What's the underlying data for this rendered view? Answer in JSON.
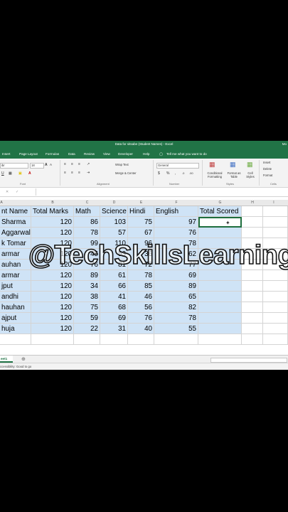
{
  "window": {
    "title": "Data for sitsabe (Student Names) - Excel",
    "user_label": "Mo"
  },
  "ribbon_tabs": [
    "Insert",
    "Page Layout",
    "Formulas",
    "Data",
    "Review",
    "View",
    "Developer",
    "Help"
  ],
  "tell_me": "Tell me what you want to do",
  "ribbon": {
    "font_name": "ibr",
    "font_size": "18",
    "wrap_text": "Wrap Text",
    "merge_center": "Merge & Center",
    "number_format": "General",
    "conditional_formatting": "Conditional Formatting",
    "format_as_table": "Format as Table",
    "cell_styles": "Cell Styles",
    "insert": "Insert",
    "delete": "Delete",
    "format": "Format",
    "groups": {
      "font": "Font",
      "alignment": "Alignment",
      "number": "Number",
      "styles": "Styles",
      "cells": "Cells"
    }
  },
  "columns": [
    "A",
    "B",
    "C",
    "D",
    "E",
    "F",
    "G",
    "H",
    "I"
  ],
  "table": {
    "headers": [
      "nt Name",
      "Total Marks",
      "Math",
      "Science",
      "Hindi",
      "English",
      "Total Scored"
    ],
    "rows": [
      [
        "Sharma",
        "120",
        "86",
        "103",
        "75",
        "97",
        ""
      ],
      [
        "Aggarwal",
        "120",
        "78",
        "57",
        "67",
        "76",
        ""
      ],
      [
        "k Tomar",
        "120",
        "99",
        "110",
        "96",
        "78",
        ""
      ],
      [
        "armar",
        "120",
        "45",
        "53",
        "36",
        "62",
        ""
      ],
      [
        "auhan",
        "120",
        "76",
        "81",
        "72",
        "77",
        ""
      ],
      [
        "armar",
        "120",
        "89",
        "61",
        "78",
        "69",
        ""
      ],
      [
        "jput",
        "120",
        "34",
        "66",
        "85",
        "89",
        ""
      ],
      [
        "andhi",
        "120",
        "38",
        "41",
        "46",
        "65",
        ""
      ],
      [
        "hauhan",
        "120",
        "75",
        "68",
        "56",
        "82",
        ""
      ],
      [
        "ajput",
        "120",
        "59",
        "69",
        "76",
        "78",
        ""
      ],
      [
        "huja",
        "120",
        "22",
        "31",
        "40",
        "55",
        ""
      ]
    ]
  },
  "sheet_tab": "eet1",
  "status_text": "ccessibility: Good to go",
  "watermark": "@TechSkillsLearning",
  "colors": {
    "excel_green": "#217346",
    "selection": "#cfe3f6"
  }
}
